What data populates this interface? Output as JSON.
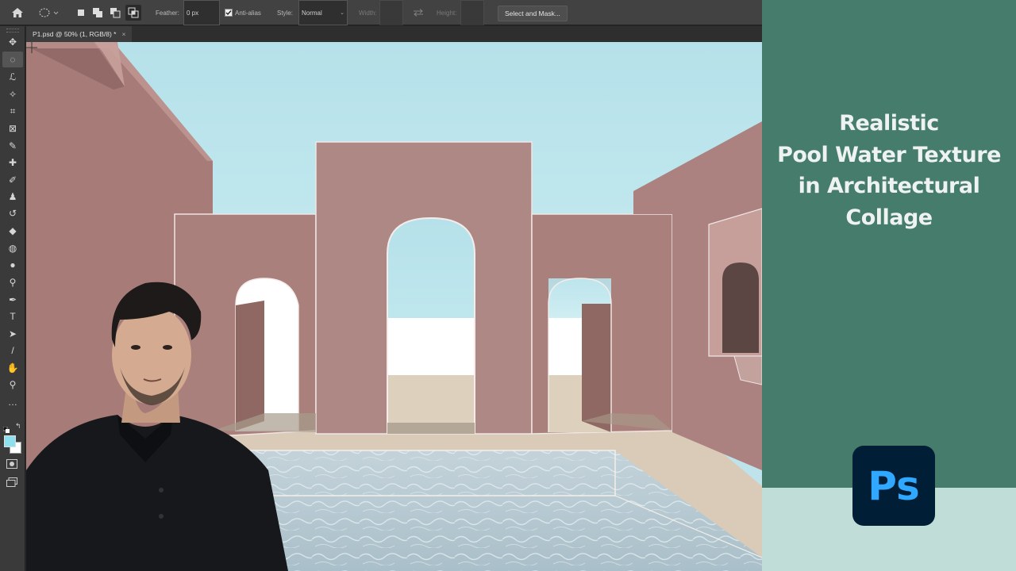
{
  "options_bar": {
    "feather_label": "Feather:",
    "feather_value": "0 px",
    "antialias_label": "Anti-alias",
    "style_label": "Style:",
    "style_value": "Normal",
    "width_label": "Width:",
    "height_label": "Height:",
    "select_mask_label": "Select and Mask..."
  },
  "document_tab": {
    "title": "P1.psd @ 50% (1, RGB/8) *",
    "close": "×"
  },
  "tools": [
    {
      "name": "move-tool",
      "glyph": "✥"
    },
    {
      "name": "elliptical-marquee-tool",
      "glyph": "◌",
      "active": true
    },
    {
      "name": "lasso-tool",
      "glyph": "ℒ"
    },
    {
      "name": "magic-wand-tool",
      "glyph": "✧"
    },
    {
      "name": "crop-tool",
      "glyph": "⌗"
    },
    {
      "name": "frame-tool",
      "glyph": "⊠"
    },
    {
      "name": "eyedropper-tool",
      "glyph": "✎"
    },
    {
      "name": "healing-brush-tool",
      "glyph": "✚"
    },
    {
      "name": "brush-tool",
      "glyph": "✐"
    },
    {
      "name": "clone-stamp-tool",
      "glyph": "♟"
    },
    {
      "name": "history-brush-tool",
      "glyph": "↺"
    },
    {
      "name": "eraser-tool",
      "glyph": "◆"
    },
    {
      "name": "paint-bucket-tool",
      "glyph": "◍"
    },
    {
      "name": "blur-tool",
      "glyph": "●"
    },
    {
      "name": "dodge-tool",
      "glyph": "⚲"
    },
    {
      "name": "pen-tool",
      "glyph": "✒"
    },
    {
      "name": "type-tool",
      "glyph": "T"
    },
    {
      "name": "path-selection-tool",
      "glyph": "➤"
    },
    {
      "name": "line-tool",
      "glyph": "/"
    },
    {
      "name": "hand-tool",
      "glyph": "✋"
    },
    {
      "name": "zoom-tool",
      "glyph": "⚲"
    },
    {
      "name": "more-tools",
      "glyph": "…"
    }
  ],
  "colors": {
    "foreground": "#8ee0ee",
    "background": "#ffffff",
    "panel_green": "#467c6c",
    "panel_mint": "#c1ddd8",
    "ps_blue": "#31a8ff",
    "ps_navy": "#001e36"
  },
  "title": {
    "line1": "Realistic",
    "line2": "Pool Water Texture",
    "line3": "in Architectural",
    "line4": "Collage"
  },
  "ps_logo_text": "Ps"
}
